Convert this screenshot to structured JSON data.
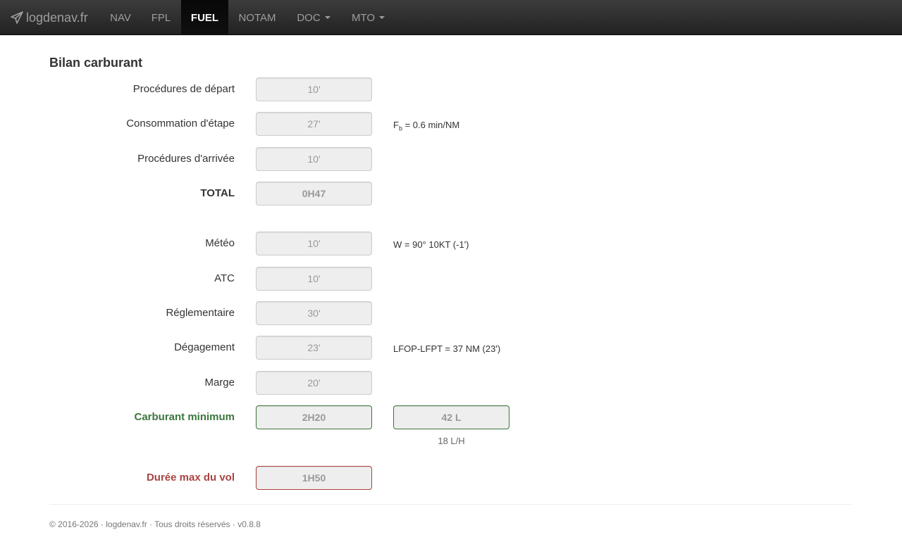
{
  "brand": {
    "name": "logdenav.fr"
  },
  "nav": {
    "items": [
      {
        "label": "NAV"
      },
      {
        "label": "FPL"
      },
      {
        "label": "FUEL"
      },
      {
        "label": "NOTAM"
      },
      {
        "label": "DOC"
      },
      {
        "label": "MTO"
      }
    ]
  },
  "page": {
    "title": "Bilan carburant"
  },
  "rows": {
    "depart": {
      "label": "Procédures de départ",
      "value": "10'"
    },
    "etape": {
      "label": "Consommation d'étape",
      "value": "27'",
      "note_prefix": "F",
      "note_sub": "b",
      "note_suffix": " = 0.6 min/NM"
    },
    "arrivee": {
      "label": "Procédures d'arrivée",
      "value": "10'"
    },
    "total": {
      "label": "TOTAL",
      "value": "0H47"
    },
    "meteo": {
      "label": "Météo",
      "value": "10'",
      "note": "W = 90° 10KT (-1')"
    },
    "atc": {
      "label": "ATC",
      "value": "10'"
    },
    "reglementaire": {
      "label": "Réglementaire",
      "value": "30'"
    },
    "degagement": {
      "label": "Dégagement",
      "value": "23'",
      "note": "LFOP-LFPT = 37 NM (23')"
    },
    "marge": {
      "label": "Marge",
      "value": "20'"
    },
    "minimum": {
      "label": "Carburant minimum",
      "value": "2H20",
      "liters": "42 L",
      "rate": "18 L/H"
    },
    "duree": {
      "label": "Durée max du vol",
      "value": "1H50"
    }
  },
  "footer": {
    "text": "© 2016-2026 · logdenav.fr · Tous droits réservés · v0.8.8"
  },
  "colors": {
    "navbar": "#222222",
    "active_nav_text": "#ffffff",
    "success": "#3c763d",
    "danger": "#a94442",
    "readonly_bg": "#eeeeee"
  }
}
